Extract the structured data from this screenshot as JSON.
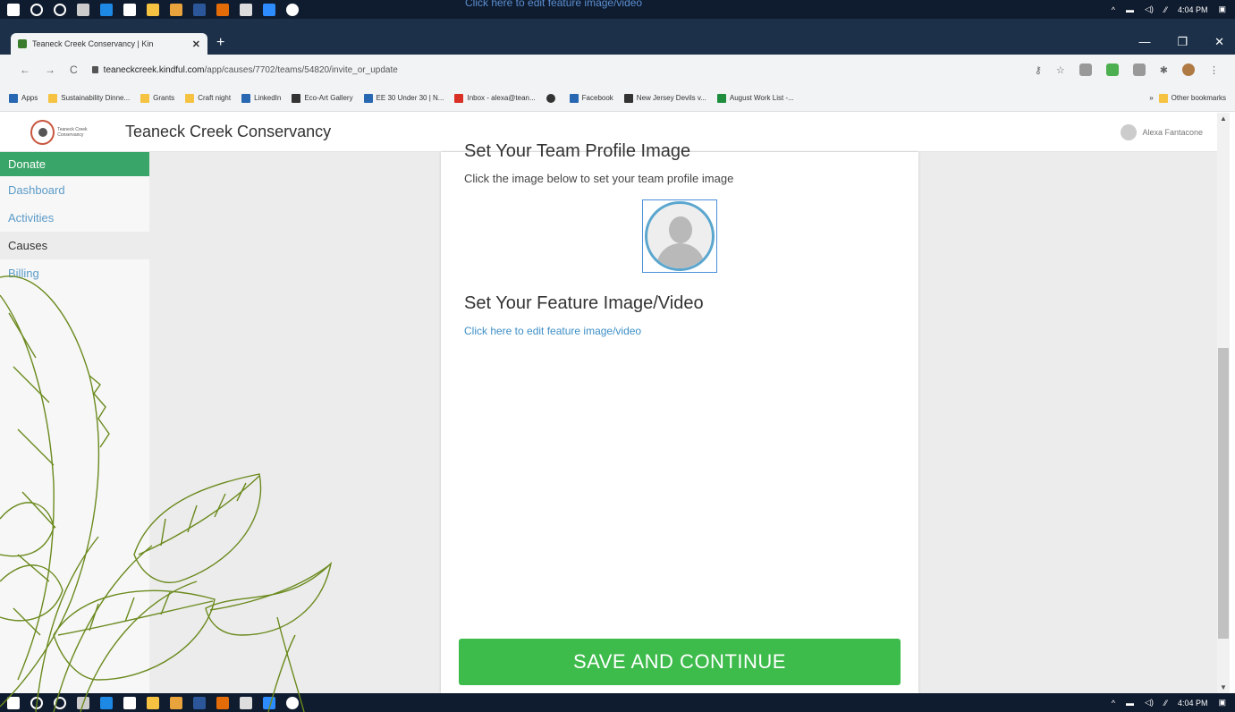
{
  "taskbar": {
    "ghost_text": "Click here to edit feature image/video",
    "time": "4:04 PM"
  },
  "browser": {
    "tab_title": "Teaneck Creek Conservancy | Kin",
    "tab_close": "✕",
    "new_tab": "+",
    "window_controls": [
      "—",
      "❐",
      "✕"
    ],
    "url_domain": "teaneckcreek.kindful.com",
    "url_path": "/app/causes/7702/teams/54820/invite_or_update",
    "bookmarks": [
      {
        "label": "Apps",
        "icon": "apps-icon"
      },
      {
        "label": "Sustainability Dinne...",
        "icon": "folder-icon"
      },
      {
        "label": "Grants",
        "icon": "folder-icon"
      },
      {
        "label": "Craft night",
        "icon": "folder-icon"
      },
      {
        "label": "LinkedIn",
        "icon": "linkedin-icon"
      },
      {
        "label": "Eco-Art Gallery",
        "icon": "eco-icon"
      },
      {
        "label": "EE 30 Under 30 | N...",
        "icon": "bird-icon"
      },
      {
        "label": "Inbox - alexa@tean...",
        "icon": "gmail-icon"
      },
      {
        "label": "",
        "icon": "globe-icon"
      },
      {
        "label": "Facebook",
        "icon": "facebook-icon"
      },
      {
        "label": "New Jersey Devils v...",
        "icon": "devils-icon"
      },
      {
        "label": "August Work List -...",
        "icon": "sheets-icon"
      }
    ],
    "bookmarks_overflow": "»",
    "other_bookmarks": "Other bookmarks"
  },
  "header": {
    "logo_text": "Teaneck Creek Conservancy",
    "org_name": "Teaneck Creek Conservancy",
    "user_name": "Alexa Fantacone"
  },
  "sidebar": {
    "items": [
      {
        "label": "Donate"
      },
      {
        "label": "Dashboard"
      },
      {
        "label": "Activities"
      },
      {
        "label": "Causes"
      },
      {
        "label": "Billing"
      }
    ]
  },
  "main": {
    "profile_title": "Set Your Team Profile Image",
    "profile_subtext": "Click the image below to set your team profile image",
    "feature_title": "Set Your Feature Image/Video",
    "feature_link": "Click here to edit feature image/video",
    "save_button": "SAVE AND CONTINUE"
  },
  "colors": {
    "accent_green": "#3dbb4b",
    "sidebar_active": "#3aa568",
    "link_blue": "#3d8fc6",
    "taskbar": "#0f1b2e",
    "leaf_stroke": "#6b8a1e"
  }
}
